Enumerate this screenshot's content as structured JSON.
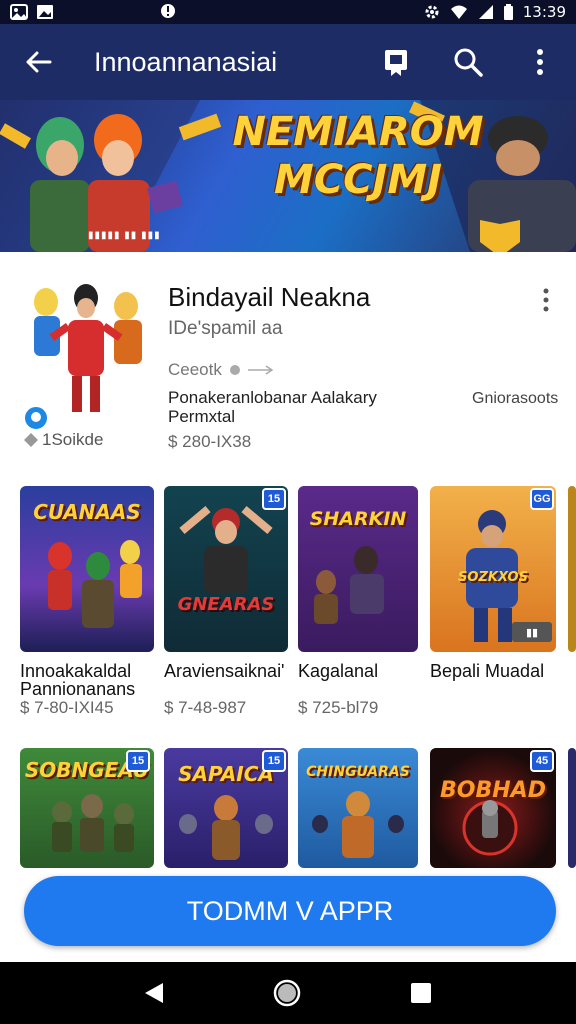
{
  "status_bar": {
    "time": "13:39",
    "icons": [
      "photo-icon",
      "image-icon",
      "alert-icon",
      "settings-icon",
      "wifi-icon",
      "signal-icon",
      "battery-icon"
    ]
  },
  "app_bar": {
    "title": "Innoannanasiai",
    "back_icon": "arrow-left-icon",
    "actions": [
      "bookmark-icon",
      "search-icon",
      "more-vert-icon"
    ]
  },
  "banner": {
    "title_line1": "NEMIAROM",
    "title_line2": "MCCJMJ",
    "stripe_text": "▮▮▮▮▮ ▮▮ ▮▮▮"
  },
  "featured": {
    "title": "Bindayail Neakna",
    "subtitle": "IDe'spamil aa",
    "rating_text": "Ceeotk",
    "description": "Ponakeranlobanar Aalakary Permxtal",
    "side_text": "Gniorasoots",
    "price": "$ 280-IX38",
    "count": "1Soikde"
  },
  "apps_row1": [
    {
      "art_title": "CUANAAS",
      "name": "Innoakakaldal Pannionanans",
      "price": "$ 7-80-IXI45",
      "badge": ""
    },
    {
      "art_title": "GNEARAS",
      "name": "Araviensaiknai'",
      "price": "$ 7-48-987",
      "badge": "15"
    },
    {
      "art_title": "SHARKIN",
      "name": "Kagalanal",
      "price": "$ 725-bl79",
      "badge": ""
    },
    {
      "art_title": "SOZKXOS",
      "name": "Bepali Muadal",
      "price": "",
      "badge": "GG"
    }
  ],
  "apps_row2": [
    {
      "art_title": "SOBNGEAU",
      "badge": "15"
    },
    {
      "art_title": "SAPAICA",
      "badge": "15"
    },
    {
      "art_title": "CHINGUARAS",
      "badge": ""
    },
    {
      "art_title": "BOBHAD",
      "badge": "45"
    }
  ],
  "cta": {
    "label": "TODMM V APPR"
  },
  "nav_bar": {
    "icons": [
      "back-triangle-icon",
      "home-circle-icon",
      "recents-square-icon"
    ]
  },
  "colors": {
    "app_bar": "#1e2c66",
    "status_bar": "#0b0f2a",
    "cta": "#1f7af0",
    "banner_text": "#ffd23a"
  }
}
